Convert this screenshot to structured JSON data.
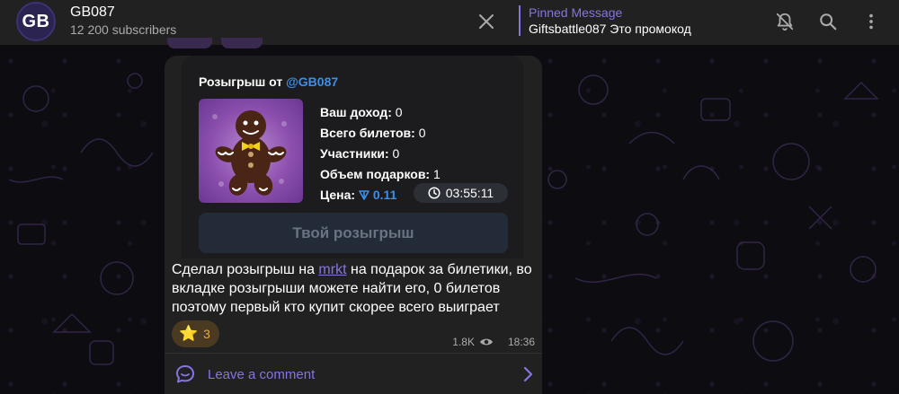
{
  "header": {
    "avatar_initials": "GB",
    "channel_title": "GB087",
    "subscribers": "12 200 subscribers",
    "pinned_title": "Pinned Message",
    "pinned_text": "Giftsbattle087 Это промокод"
  },
  "giveaway_card": {
    "title_prefix": "Розыгрыш от ",
    "title_mention": "@GB087",
    "income_label": "Ваш доход:",
    "income_value": " 0",
    "tickets_label": "Всего билетов:",
    "tickets_value": " 0",
    "participants_label": "Участники:",
    "participants_value": " 0",
    "gifts_volume_label": "Объем подарков:",
    "gifts_volume_value": " 1",
    "price_label": "Цена:",
    "price_value": "0.11",
    "timer": "03:55:11",
    "button_label": "Твой розыгрыш"
  },
  "message": {
    "text_before": "Сделал розыгрыш на ",
    "link_text": "mrkt",
    "text_after": " на подарок за билетики, во вкладке розыгрыши можете найти его, 0 билетов поэтому первый кто купит скорее всего выиграет",
    "reaction_emoji": "⭐",
    "reaction_count": "3",
    "views": "1.8K",
    "time": "18:36",
    "comment_label": "Leave a comment"
  },
  "colors": {
    "accent": "#8774e1",
    "ton_blue": "#3e8ee8",
    "header_bg": "#212121",
    "bubble_bg": "#212121"
  },
  "icons": {
    "close": "close-icon",
    "mute": "bell-off-icon",
    "search": "search-icon",
    "menu": "more-vertical-icon",
    "views": "eye-icon",
    "comment": "comment-icon",
    "chevron": "chevron-right-icon",
    "timer": "clock-icon",
    "ton": "ton-icon"
  }
}
